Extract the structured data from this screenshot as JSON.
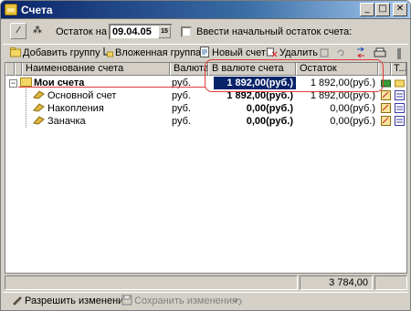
{
  "window": {
    "title": "Счета",
    "buttons": {
      "minimize": "_",
      "maximize": "□",
      "close": "✕"
    }
  },
  "toolbar": {
    "date_label": "Остаток на",
    "date_value": "09.04.05",
    "calendar_icon_text": "15",
    "checkbox_label": "Ввести начальный остаток счета:",
    "checkbox_checked": false
  },
  "actions": {
    "add_group": "Добавить группу",
    "nested_group": "Вложенная группа",
    "new_account": "Новый счет",
    "delete": "Удалить"
  },
  "columns": {
    "name": "Наименование счета",
    "currency": "Валюта",
    "in_currency": "В валюте счета",
    "balance": "Остаток",
    "t": "Т..."
  },
  "rows": [
    {
      "name": "Мои счета",
      "currency": "руб.",
      "in_currency": "1 892,00(руб.)",
      "balance": "1 892,00(руб.)",
      "bold": true,
      "group": true
    },
    {
      "name": "Основной счет",
      "currency": "руб.",
      "in_currency": "1 892,00(руб.)",
      "balance": "1 892,00(руб.)"
    },
    {
      "name": "Накопления",
      "currency": "руб.",
      "in_currency": "0,00(руб.)",
      "balance": "0,00(руб.)"
    },
    {
      "name": "Заначка",
      "currency": "руб.",
      "in_currency": "0,00(руб.)",
      "balance": "0,00(руб.)"
    }
  ],
  "total": "3 784,00",
  "bottom": {
    "allow_changes": "Разрешить изменения",
    "save_changes": "Сохранить изменения"
  },
  "colors": {
    "highlight": "#e43a3a",
    "selection": "#0a246a",
    "title_bar": "#0a246a"
  }
}
